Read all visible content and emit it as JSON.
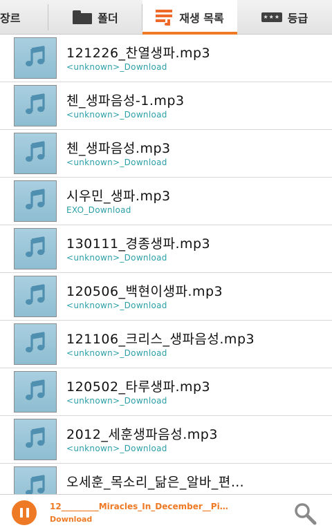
{
  "tabs": [
    {
      "label": "장르",
      "icon": "none",
      "active": false
    },
    {
      "label": "폴더",
      "icon": "folder-icon",
      "active": false
    },
    {
      "label": "재생 목록",
      "icon": "playlist-icon",
      "active": true
    },
    {
      "label": "등급",
      "icon": "rating-icon",
      "active": false
    }
  ],
  "rating_badge": "★★★",
  "songs": [
    {
      "title": "121226_찬열생파.mp3",
      "artist": "<unknown>_Download"
    },
    {
      "title": "첸_생파음성-1.mp3",
      "artist": "<unknown>_Download"
    },
    {
      "title": "첸_생파음성.mp3",
      "artist": "<unknown>_Download"
    },
    {
      "title": "시우민_생파.mp3",
      "artist": "EXO_Download"
    },
    {
      "title": "130111_경종생파.mp3",
      "artist": "<unknown>_Download"
    },
    {
      "title": "120506_백현이생파.mp3",
      "artist": "<unknown>_Download"
    },
    {
      "title": "121106_크리스_생파음성.mp3",
      "artist": "<unknown>_Download"
    },
    {
      "title": "120502_타루생파.mp3",
      "artist": "<unknown>_Download"
    },
    {
      "title": "2012_세훈생파음성.mp3",
      "artist": "<unknown>_Download"
    },
    {
      "title": "오세훈_목소리_닮은_알바_편…",
      "artist": ""
    }
  ],
  "now_playing": {
    "title": "12_________Miracles_In_December__Pi…",
    "subtitle": "Download"
  },
  "colors": {
    "accent": "#ef7a25",
    "artist_text": "#2a9fa6",
    "thumb": "#9cc6d9"
  }
}
